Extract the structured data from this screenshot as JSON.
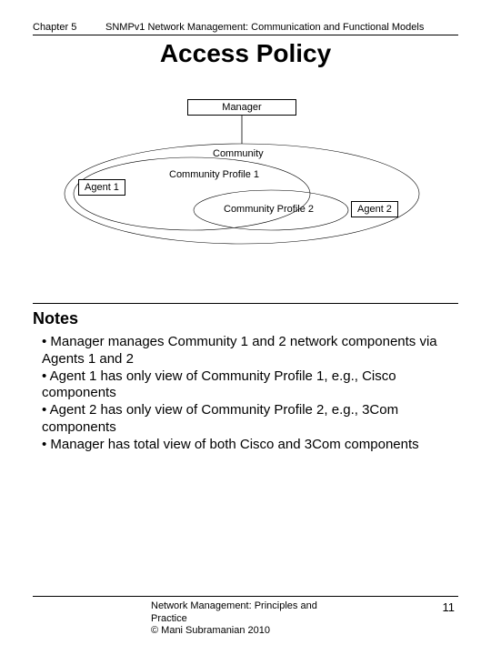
{
  "header": {
    "chapter": "Chapter 5",
    "subtitle": "SNMPv1 Network Management: Communication and Functional Models"
  },
  "title": "Access Policy",
  "diagram": {
    "manager": "Manager",
    "community": "Community",
    "agent1": "Agent 1",
    "cp1": "Community Profile 1",
    "cp2": "Community Profile 2",
    "agent2": "Agent 2"
  },
  "notes": {
    "heading": "Notes",
    "items": [
      "Manager manages Community 1 and 2 network components via Agents 1 and 2",
      "Agent 1 has only view of Community Profile 1, e.g., Cisco components",
      "Agent 2 has only view of Community Profile 2, e.g., 3Com components",
      "Manager has total view of both Cisco and 3Com components"
    ]
  },
  "footer": {
    "line1": "Network Management: Principles and",
    "line2": "Practice",
    "line3": "© Mani Subramanian 2010",
    "page": "11"
  }
}
